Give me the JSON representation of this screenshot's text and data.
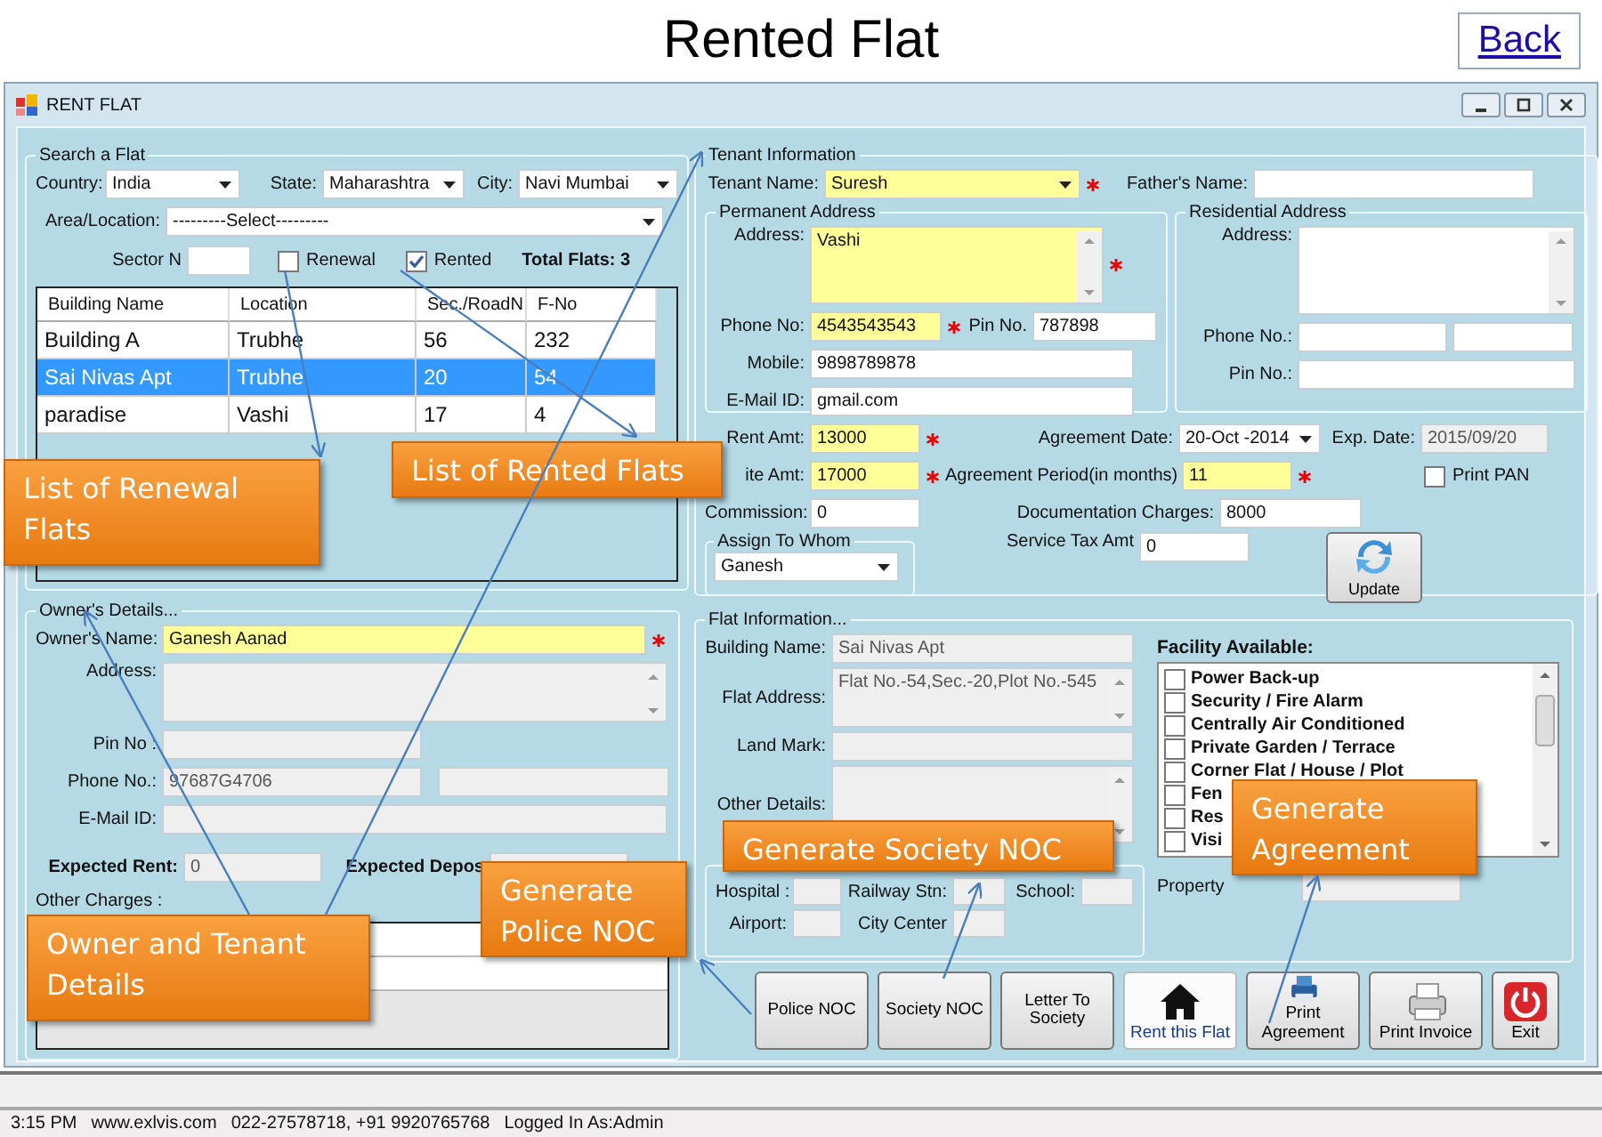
{
  "slide": {
    "title": "Rented Flat",
    "back_link": "Back"
  },
  "window": {
    "title": "RENT FLAT"
  },
  "search": {
    "legend": "Search a Flat",
    "fields": [
      {
        "label": "Country:",
        "value": "India",
        "kind": "combo",
        "required": false,
        "disabled": false
      },
      {
        "label": "State:",
        "value": "Maharashtra",
        "kind": "combo",
        "required": false,
        "disabled": false
      },
      {
        "label": "City:",
        "value": "Navi Mumbai",
        "kind": "combo",
        "required": false,
        "disabled": false
      },
      {
        "label": "Area/Location:",
        "value": "---------Select---------",
        "kind": "combo",
        "required": false,
        "disabled": false
      },
      {
        "label": "Sector N",
        "kind": "text",
        "required": false,
        "disabled": false
      }
    ],
    "renewal": {
      "label": "Renewal",
      "checked": false
    },
    "rented": {
      "label": "Rented",
      "checked": true
    },
    "total": "Total Flats: 3"
  },
  "flats_table": {
    "columns": [
      "Building Name",
      "Location",
      "Sec./RoadN",
      "F-No"
    ],
    "rows": [
      {
        "cells": [
          "Building A",
          "Trubhe",
          "56",
          "232"
        ],
        "selected": false
      },
      {
        "cells": [
          "Sai Nivas Apt",
          "Trubhe",
          "20",
          "54"
        ],
        "selected": true
      },
      {
        "cells": [
          "paradise",
          "Vashi",
          "17",
          "4"
        ],
        "selected": false
      }
    ]
  },
  "owner": {
    "legend": "Owner's Details...",
    "fields": [
      {
        "label": "Owner's Name:",
        "value": "Ganesh Aanad",
        "kind": "text",
        "required": true,
        "disabled": false
      },
      {
        "label": "Address:",
        "kind": "memo",
        "required": false,
        "disabled": true
      },
      {
        "label": "Pin No :",
        "kind": "text",
        "required": false,
        "disabled": true
      },
      {
        "label": "Phone No.:",
        "value": "97687G4706",
        "kind": "text",
        "required": false,
        "disabled": true
      },
      {
        "kind": "text",
        "required": false,
        "disabled": true
      },
      {
        "label": "E-Mail ID:",
        "kind": "text",
        "required": false,
        "disabled": true
      },
      {
        "label": "Expected Rent:",
        "value": "0",
        "kind": "text",
        "required": false,
        "disabled": true
      },
      {
        "label": "Expected  Depos",
        "kind": "text",
        "required": false,
        "disabled": true
      }
    ],
    "other_charges_label": "Other Charges :"
  },
  "tenant": {
    "legend": "Tenant Information",
    "fields": [
      {
        "label": "Tenant Name:",
        "value": "Suresh",
        "kind": "combo",
        "required": true,
        "disabled": false
      },
      {
        "label": "Father's Name:",
        "kind": "text",
        "required": false,
        "disabled": false
      }
    ],
    "permanent": {
      "legend": "Permanent Address",
      "fields": [
        {
          "label": "Address:",
          "value": "Vashi",
          "kind": "memo",
          "required": true,
          "disabled": false
        },
        {
          "label": "Phone No:",
          "value": "4543543543",
          "kind": "text",
          "required": true,
          "disabled": false
        },
        {
          "label": "Pin No.",
          "value": "787898",
          "kind": "text",
          "required": false,
          "disabled": false
        },
        {
          "label": "Mobile:",
          "value": "9898789878",
          "kind": "text",
          "required": false,
          "disabled": false
        },
        {
          "label": "E-Mail ID:",
          "value": "gmail.com",
          "kind": "text",
          "required": false,
          "disabled": false
        }
      ]
    },
    "residential": {
      "legend": "Residential Address",
      "fields": [
        {
          "label": "Address:",
          "kind": "memo",
          "required": false,
          "disabled": false
        },
        {
          "label": "Phone No.:",
          "kind": "text",
          "required": false,
          "disabled": false
        },
        {
          "kind": "text",
          "required": false,
          "disabled": false
        },
        {
          "label": "Pin No.:",
          "kind": "text",
          "required": false,
          "disabled": false
        }
      ]
    },
    "payment_fields": [
      {
        "label": "Rent Amt:",
        "value": "13000",
        "kind": "text",
        "required": true,
        "disabled": false
      },
      {
        "label": "Agreement Date:",
        "value": "20-Oct -2014",
        "kind": "combo",
        "required": false,
        "disabled": false
      },
      {
        "label": "Exp. Date:",
        "value": "2015/09/20",
        "kind": "text",
        "required": false,
        "disabled": true
      },
      {
        "label": "ite Amt:",
        "value": "17000",
        "kind": "text",
        "required": true,
        "disabled": false
      },
      {
        "label": "Agreement Period(in months)",
        "value": "11",
        "kind": "text",
        "required": true,
        "disabled": false
      },
      {
        "label": "Commission:",
        "value": "0",
        "kind": "text",
        "required": false,
        "disabled": false
      },
      {
        "label": "Documentation Charges:",
        "value": "8000",
        "kind": "text",
        "required": false,
        "disabled": false
      },
      {
        "label": "Service Tax Amt",
        "value": "0",
        "kind": "text",
        "required": false,
        "disabled": false
      }
    ],
    "print_pan": {
      "label": "Print PAN",
      "checked": false
    },
    "assign": {
      "legend": "Assign  To Whom",
      "value": "Ganesh"
    },
    "update_button": "Update"
  },
  "flat": {
    "legend": "Flat Information...",
    "fields": [
      {
        "label": "Building Name:",
        "value": "Sai Nivas Apt",
        "kind": "text",
        "required": false,
        "disabled": true
      },
      {
        "label": "Flat Address:",
        "value": "Flat No.-54,Sec.-20,Plot No.-545",
        "kind": "memo",
        "required": false,
        "disabled": true
      },
      {
        "label": "Land Mark:",
        "kind": "text",
        "required": false,
        "disabled": true
      },
      {
        "label": "Other Details:",
        "kind": "memo",
        "required": false,
        "disabled": true
      }
    ],
    "distance": [
      {
        "label": "Hospital :",
        "kind": "text",
        "required": false,
        "disabled": true
      },
      {
        "label": "Railway Stn:",
        "kind": "text",
        "required": false,
        "disabled": true
      },
      {
        "label": "School:",
        "kind": "text",
        "required": false,
        "disabled": true
      },
      {
        "label": "Airport:",
        "kind": "text",
        "required": false,
        "disabled": true
      },
      {
        "label": "City Center",
        "kind": "text",
        "required": false,
        "disabled": true
      }
    ],
    "facility": {
      "title": "Facility Available:",
      "items": [
        {
          "label": "Power Back-up",
          "checked": false
        },
        {
          "label": "Security / Fire Alarm",
          "checked": false
        },
        {
          "label": "Centrally Air Conditioned",
          "checked": false
        },
        {
          "label": "Private Garden / Terrace",
          "checked": false
        },
        {
          "label": "Corner Flat / House / Plot",
          "checked": false
        },
        {
          "label": "Fen",
          "checked": false
        },
        {
          "label": "Res",
          "checked": false
        },
        {
          "label": "Visi",
          "checked": false
        }
      ]
    },
    "property_label": "Property"
  },
  "buttons": [
    {
      "label": "Police NOC",
      "kind": "text",
      "selected": false
    },
    {
      "label": "Society NOC",
      "kind": "text",
      "selected": false
    },
    {
      "label": "Letter To Society",
      "kind": "text",
      "selected": false
    },
    {
      "label": "Rent this Flat",
      "kind": "home",
      "selected": true
    },
    {
      "label": "Print Agreement",
      "kind": "print",
      "selected": false
    },
    {
      "label": "Print Invoice",
      "kind": "invoice",
      "selected": false
    },
    {
      "label": "Exit",
      "kind": "exit",
      "selected": false
    }
  ],
  "status_bar": [
    "3:15 PM",
    "www.exlvis.com",
    "022-27578718, +91 9920765768",
    "Logged In As:Admin"
  ],
  "callouts": [
    {
      "text": "List of Renewal Flats"
    },
    {
      "text": "List of Rented Flats"
    },
    {
      "text": "Owner and Tenant Details"
    },
    {
      "text": "Generate Police NOC"
    },
    {
      "text": "Generate Society NOC"
    },
    {
      "text": "Generate Agreement"
    }
  ]
}
